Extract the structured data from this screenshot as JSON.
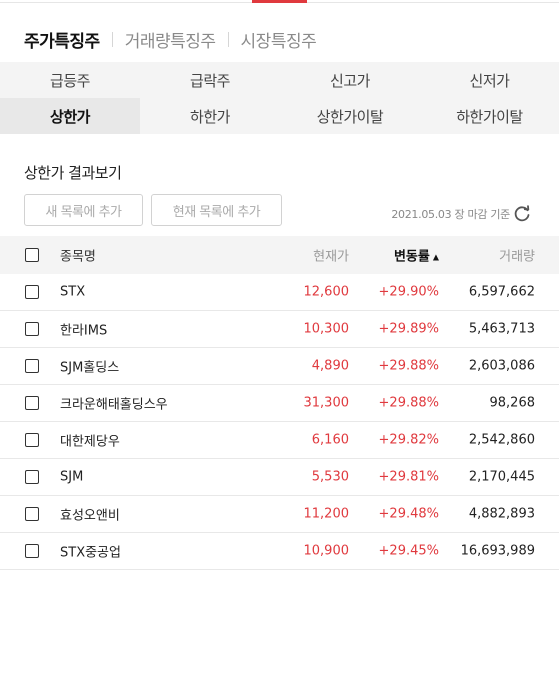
{
  "main_tabs": [
    "주가특징주",
    "거래량특징주",
    "시장특징주"
  ],
  "sub_tabs_row1": [
    "급등주",
    "급락주",
    "신고가",
    "신저가"
  ],
  "sub_tabs_row2": [
    "상한가",
    "하한가",
    "상한가이탈",
    "하한가이탈"
  ],
  "section_title": "상한가 결과보기",
  "buttons": {
    "new_list": "새 목록에 추가",
    "current_list": "현재 목록에 추가"
  },
  "as_of": "2021.05.03 장 마감 기준",
  "table": {
    "headers": {
      "name": "종목명",
      "price": "현재가",
      "rate": "변동률",
      "volume": "거래량",
      "sort_arrow": "▲"
    },
    "rows": [
      {
        "name": "STX",
        "price": "12,600",
        "rate": "+29.90%",
        "volume": "6,597,662"
      },
      {
        "name": "한라IMS",
        "price": "10,300",
        "rate": "+29.89%",
        "volume": "5,463,713"
      },
      {
        "name": "SJM홀딩스",
        "price": "4,890",
        "rate": "+29.88%",
        "volume": "2,603,086"
      },
      {
        "name": "크라운해태홀딩스우",
        "price": "31,300",
        "rate": "+29.88%",
        "volume": "98,268"
      },
      {
        "name": "대한제당우",
        "price": "6,160",
        "rate": "+29.82%",
        "volume": "2,542,860"
      },
      {
        "name": "SJM",
        "price": "5,530",
        "rate": "+29.81%",
        "volume": "2,170,445"
      },
      {
        "name": "효성오앤비",
        "price": "11,200",
        "rate": "+29.48%",
        "volume": "4,882,893"
      },
      {
        "name": "STX중공업",
        "price": "10,900",
        "rate": "+29.45%",
        "volume": "16,693,989"
      }
    ]
  },
  "colors": {
    "accent": "#e0393e",
    "up": "#e0393e"
  },
  "icons": {
    "refresh": "refresh-icon"
  }
}
